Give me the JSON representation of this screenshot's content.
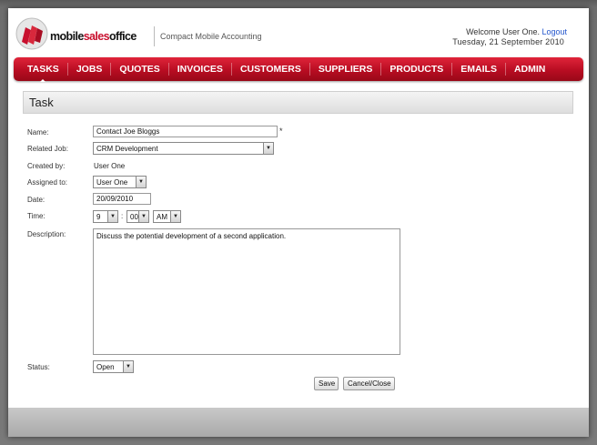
{
  "header": {
    "brand_part1": "mobile",
    "brand_part2": "sales",
    "brand_part3": "office",
    "tagline": "Compact Mobile Accounting",
    "welcome": "Welcome User One.",
    "logout": "Logout",
    "date": "Tuesday, 21 September 2010"
  },
  "nav": {
    "items": [
      "TASKS",
      "JOBS",
      "QUOTES",
      "INVOICES",
      "CUSTOMERS",
      "SUPPLIERS",
      "PRODUCTS",
      "EMAILS",
      "ADMIN"
    ],
    "active": "TASKS"
  },
  "panel": {
    "title": "Task"
  },
  "form": {
    "name_label": "Name:",
    "name_value": "Contact Joe Bloggs",
    "required_mark": "*",
    "related_job_label": "Related Job:",
    "related_job_value": "CRM Development",
    "created_by_label": "Created by:",
    "created_by_value": "User One",
    "assigned_to_label": "Assigned to:",
    "assigned_to_value": "User One",
    "date_label": "Date:",
    "date_value": "20/09/2010",
    "time_label": "Time:",
    "time_hour": "9",
    "time_separator": ":",
    "time_minute": "00",
    "time_ampm": "AM",
    "description_label": "Description:",
    "description_value": "Discuss the potential development of a second application.",
    "status_label": "Status:",
    "status_value": "Open"
  },
  "buttons": {
    "save": "Save",
    "cancel": "Cancel/Close"
  },
  "icons": {
    "logo": "mobile-sales-office-logo-icon",
    "dropdown": "dropdown-arrow-icon"
  },
  "colors": {
    "accent": "#c8102e",
    "link": "#2255cc"
  }
}
